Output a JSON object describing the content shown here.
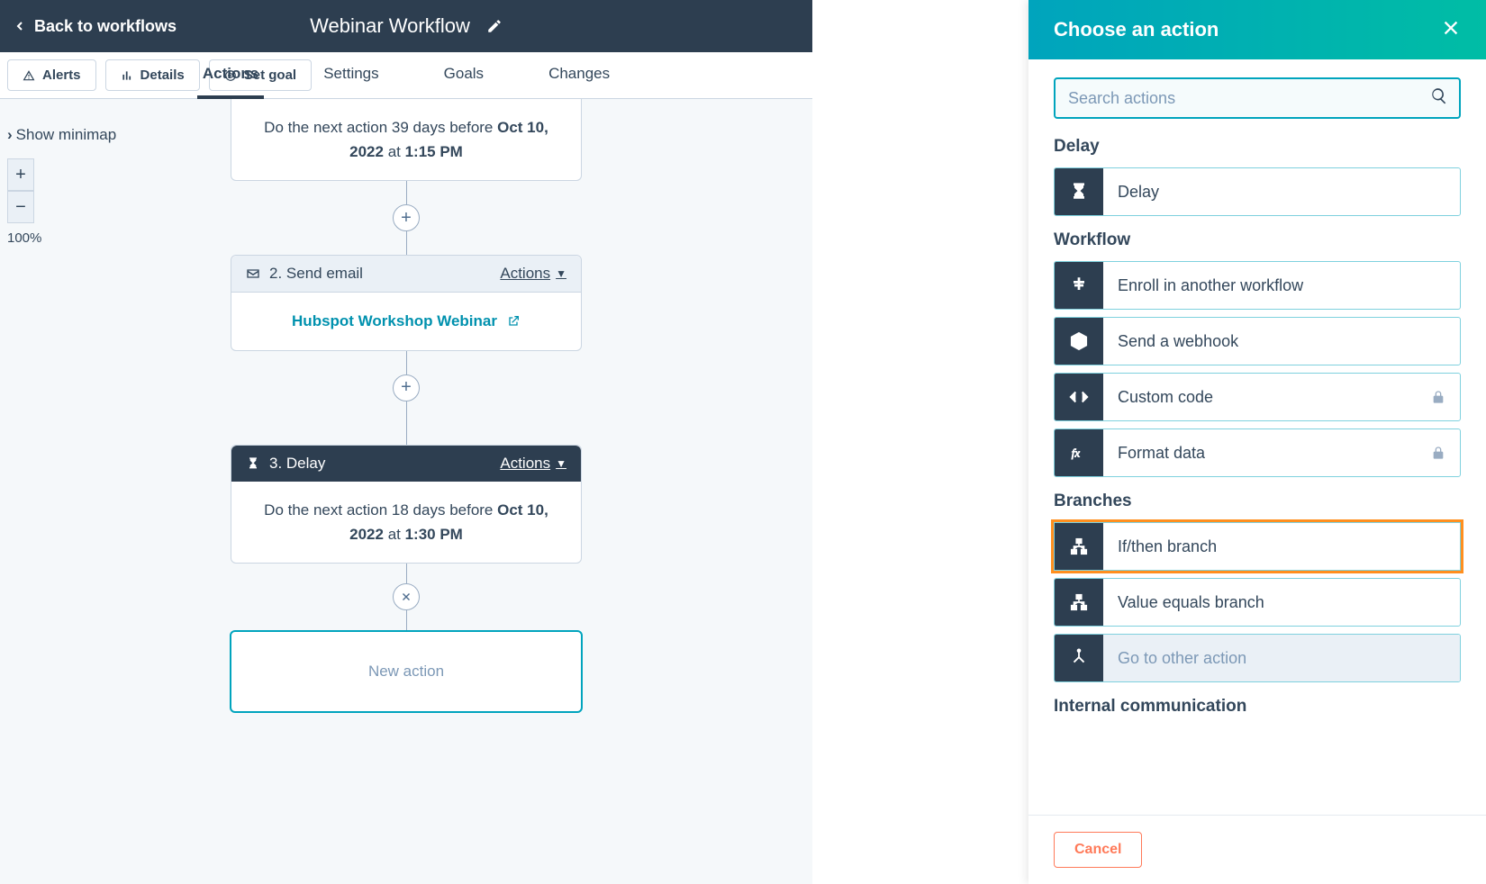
{
  "header": {
    "back_label": "Back to workflows",
    "title": "Webinar Workflow"
  },
  "toolbar": {
    "alerts": "Alerts",
    "details": "Details",
    "set_goal": "Set goal"
  },
  "tabs": {
    "actions": "Actions",
    "settings": "Settings",
    "goals": "Goals",
    "changes": "Changes"
  },
  "canvas": {
    "show_minimap": "Show minimap",
    "zoom": "100%",
    "node1_prefix": "Do the next action 39 days before ",
    "node1_date": "Oct 10, 2022",
    "node1_at": " at ",
    "node1_time": "1:15 PM",
    "node2_title": "2. Send email",
    "node2_actions": "Actions",
    "node2_link": "Hubspot Workshop Webinar",
    "node3_title": "3. Delay",
    "node3_actions": "Actions",
    "node3_prefix": "Do the next action 18 days before ",
    "node3_date": "Oct 10, 2022",
    "node3_at": " at ",
    "node3_time": "1:30 PM",
    "new_action": "New action"
  },
  "panel": {
    "title": "Choose an action",
    "search_placeholder": "Search actions",
    "group_delay": "Delay",
    "item_delay": "Delay",
    "group_workflow": "Workflow",
    "item_enroll": "Enroll in another workflow",
    "item_webhook": "Send a webhook",
    "item_custom_code": "Custom code",
    "item_format_data": "Format data",
    "group_branches": "Branches",
    "item_if_then": "If/then branch",
    "item_value_equals": "Value equals branch",
    "item_goto": "Go to other action",
    "group_internal": "Internal communication",
    "cancel": "Cancel"
  }
}
